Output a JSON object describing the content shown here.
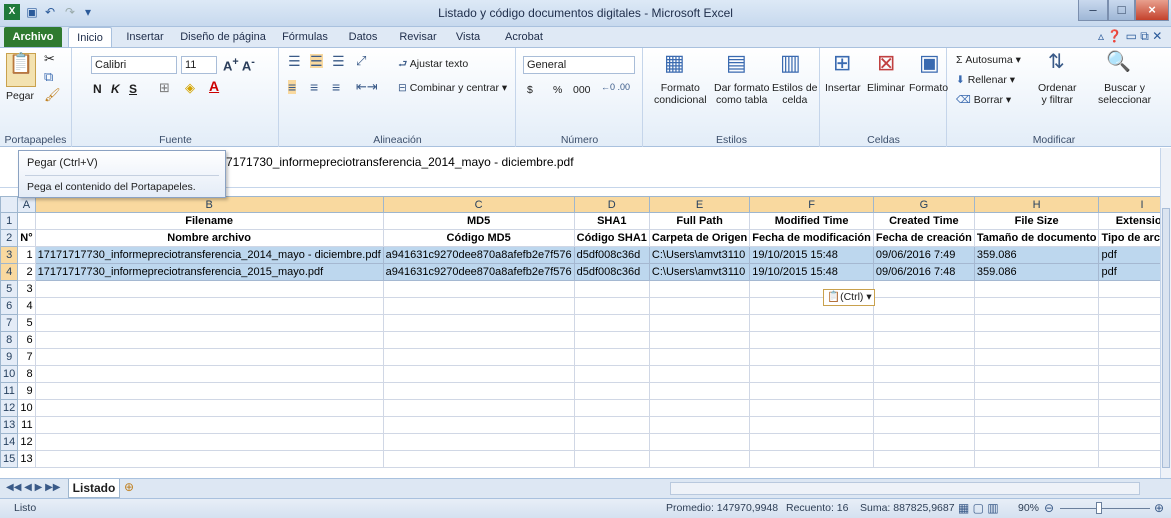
{
  "window": {
    "title": "Listado y código documentos digitales - Microsoft Excel"
  },
  "tabs": [
    "Archivo",
    "Inicio",
    "Insertar",
    "Diseño de página",
    "Fórmulas",
    "Datos",
    "Revisar",
    "Vista",
    "Acrobat"
  ],
  "ribbon": {
    "paste": "Pegar",
    "font_name": "Calibri",
    "font_size": "11",
    "bold": "N",
    "italic": "K",
    "underline": "S",
    "wrap_text": "Ajustar texto",
    "merge_center": "Combinar y centrar",
    "number_format": "General",
    "currency": "$",
    "percent": "%",
    "thousands": "000",
    "conditional_format": [
      "Formato",
      "condicional"
    ],
    "format_table": [
      "Dar formato",
      "como tabla"
    ],
    "cell_styles": [
      "Estilos de",
      "celda"
    ],
    "insert": "Insertar",
    "delete": "Eliminar",
    "format": "Formato",
    "autosum": "Autosuma",
    "fill": "Rellenar",
    "clear": "Borrar",
    "sort_filter": [
      "Ordenar",
      "y filtrar"
    ],
    "find_select": [
      "Buscar y",
      "seleccionar"
    ],
    "groups": [
      "Portapapeles",
      "Fuente",
      "Alineación",
      "Número",
      "Estilos",
      "Celdas",
      "Modificar"
    ]
  },
  "tooltip": {
    "title": "Pegar (Ctrl+V)",
    "body": "Pega el contenido del Portapapeles."
  },
  "formula_bar": {
    "content": "7171730_informepreciotransferencia_2014_mayo - diciembre.pdf"
  },
  "columns": [
    "A",
    "B",
    "C",
    "D",
    "E",
    "F",
    "G",
    "H",
    "I"
  ],
  "rows": [
    {
      "n": "1",
      "cells": [
        "",
        "Filename",
        "MD5",
        "SHA1",
        "Full Path",
        "Modified Time",
        "Created Time",
        "File Size",
        "Extension"
      ]
    },
    {
      "n": "2",
      "cells": [
        "N°",
        "Nombre archivo",
        "Código MD5",
        "Código SHA1",
        "Carpeta de Origen",
        "Fecha de modificación",
        "Fecha de creación",
        "Tamaño de documento",
        "Tipo de archivo"
      ]
    },
    {
      "n": "3",
      "cells": [
        "1",
        "17171717730_informepreciotransferencia_2014_mayo - diciembre.pdf",
        "a941631c9270dee870a8afefb2e7f576",
        "d5df008c36d",
        "C:\\Users\\amvt3110",
        "19/10/2015 15:48",
        "09/06/2016 7:49",
        "359.086",
        "pdf"
      ]
    },
    {
      "n": "4",
      "cells": [
        "2",
        "17171717730_informepreciotransferencia_2015_mayo.pdf",
        "a941631c9270dee870a8afefb2e7f576",
        "d5df008c36d",
        "C:\\Users\\amvt3110",
        "19/10/2015 15:48",
        "09/06/2016 7:48",
        "359.086",
        "pdf"
      ]
    },
    {
      "n": "5",
      "cells": [
        "3",
        "",
        "",
        "",
        "",
        "",
        "",
        "",
        ""
      ]
    },
    {
      "n": "6",
      "cells": [
        "4",
        "",
        "",
        "",
        "",
        "",
        "",
        "",
        ""
      ]
    },
    {
      "n": "7",
      "cells": [
        "5",
        "",
        "",
        "",
        "",
        "",
        "",
        "",
        ""
      ]
    },
    {
      "n": "8",
      "cells": [
        "6",
        "",
        "",
        "",
        "",
        "",
        "",
        "",
        ""
      ]
    },
    {
      "n": "9",
      "cells": [
        "7",
        "",
        "",
        "",
        "",
        "",
        "",
        "",
        ""
      ]
    },
    {
      "n": "10",
      "cells": [
        "8",
        "",
        "",
        "",
        "",
        "",
        "",
        "",
        ""
      ]
    },
    {
      "n": "11",
      "cells": [
        "9",
        "",
        "",
        "",
        "",
        "",
        "",
        "",
        ""
      ]
    },
    {
      "n": "12",
      "cells": [
        "10",
        "",
        "",
        "",
        "",
        "",
        "",
        "",
        ""
      ]
    },
    {
      "n": "13",
      "cells": [
        "11",
        "",
        "",
        "",
        "",
        "",
        "",
        "",
        ""
      ]
    },
    {
      "n": "14",
      "cells": [
        "12",
        "",
        "",
        "",
        "",
        "",
        "",
        "",
        ""
      ]
    },
    {
      "n": "15",
      "cells": [
        "13",
        "",
        "",
        "",
        "",
        "",
        "",
        "",
        ""
      ]
    }
  ],
  "paste_options": "(Ctrl)",
  "sheet_tab": "Listado",
  "status": {
    "ready": "Listo",
    "average": "Promedio: 147970,9948",
    "count": "Recuento: 16",
    "sum": "Suma: 887825,9687",
    "zoom": "90%"
  }
}
